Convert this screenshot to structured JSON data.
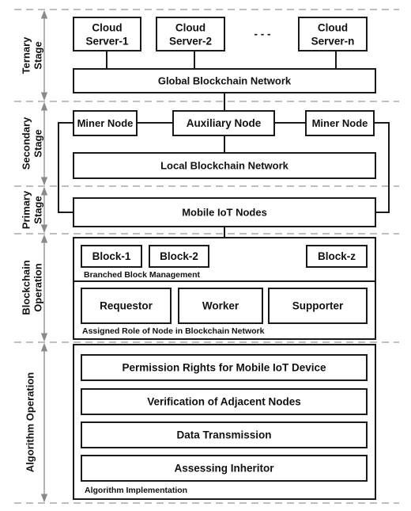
{
  "diagram": {
    "stages": [
      {
        "id": "ternary",
        "label_lines": [
          "Ternary",
          "Stage"
        ]
      },
      {
        "id": "secondary",
        "label_lines": [
          "Secondary",
          "Stage"
        ]
      },
      {
        "id": "primary",
        "label_lines": [
          "Primary",
          "Stage"
        ]
      },
      {
        "id": "blockchain",
        "label_lines": [
          "Blockchain",
          "Operation"
        ]
      },
      {
        "id": "algorithm",
        "label_lines": [
          "Algorithm Operation"
        ]
      }
    ],
    "ternary": {
      "servers": [
        {
          "line1": "Cloud",
          "line2": "Server-1"
        },
        {
          "line1": "Cloud",
          "line2": "Server-2"
        },
        {
          "line1": "Cloud",
          "line2": "Server-n"
        }
      ],
      "ellipsis": "- - -",
      "network": "Global Blockchain Network"
    },
    "secondary": {
      "miner_left": "Miner Node",
      "auxiliary": "Auxiliary Node",
      "miner_right": "Miner Node",
      "network": "Local Blockchain Network"
    },
    "primary": {
      "nodes": "Mobile IoT Nodes"
    },
    "blockchain_operation": {
      "blocks": [
        "Block-1",
        "Block-2",
        "Block-z"
      ],
      "blocks_caption": "Branched Block Management",
      "roles": [
        "Requestor",
        "Worker",
        "Supporter"
      ],
      "roles_caption": "Assigned Role of Node in Blockchain Network"
    },
    "algorithm_operation": {
      "steps": [
        "Permission Rights for Mobile IoT Device",
        "Verification of Adjacent Nodes",
        "Data Transmission",
        "Assessing Inheritor"
      ],
      "caption": "Algorithm Implementation"
    }
  }
}
